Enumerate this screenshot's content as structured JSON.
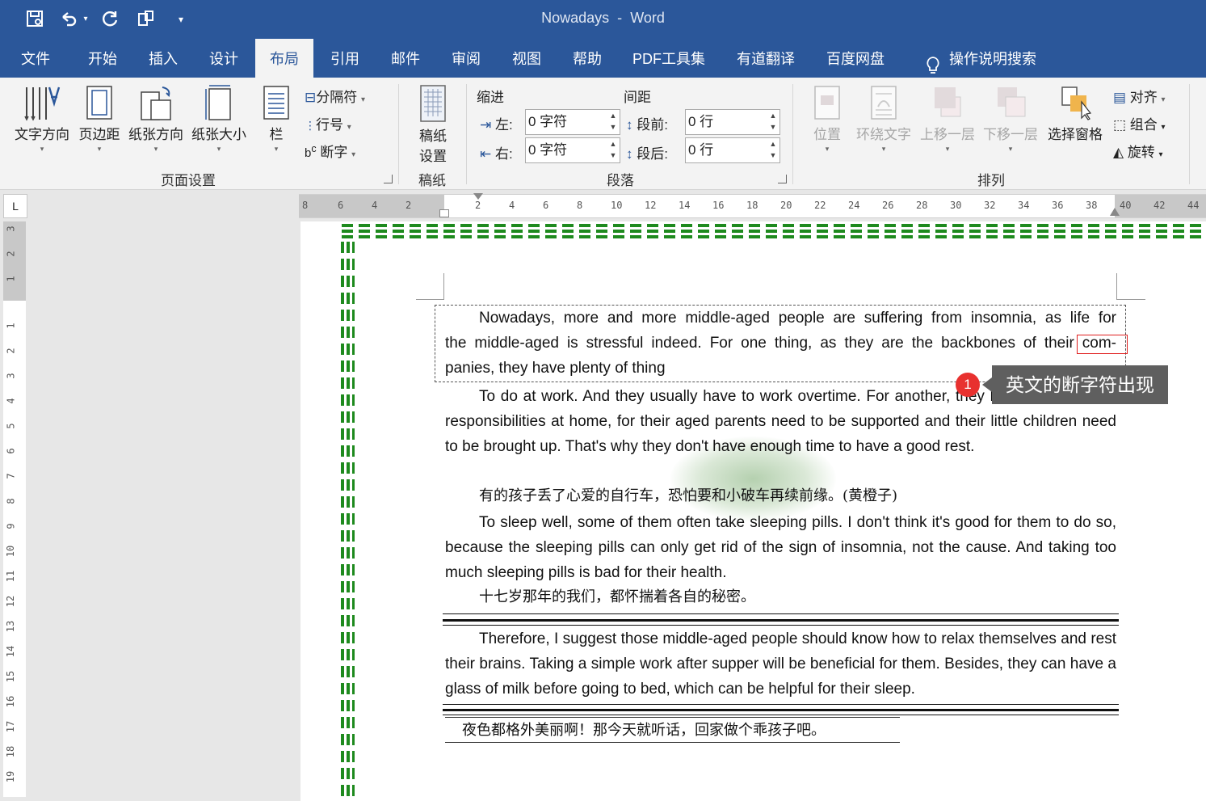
{
  "titlebar": {
    "doc_name": "Nowadays",
    "sep": "-",
    "app": "Word"
  },
  "tabs": [
    {
      "label": "文件"
    },
    {
      "label": "开始"
    },
    {
      "label": "插入"
    },
    {
      "label": "设计"
    },
    {
      "label": "布局",
      "active": true
    },
    {
      "label": "引用"
    },
    {
      "label": "邮件"
    },
    {
      "label": "审阅"
    },
    {
      "label": "视图"
    },
    {
      "label": "帮助"
    },
    {
      "label": "PDF工具集"
    },
    {
      "label": "有道翻译"
    },
    {
      "label": "百度网盘"
    },
    {
      "label": "操作说明搜索"
    }
  ],
  "ribbon": {
    "page_setup": {
      "text_direction": "文字方向",
      "margins": "页边距",
      "orientation": "纸张方向",
      "size": "纸张大小",
      "columns": "栏",
      "breaks": "分隔符",
      "line_numbers": "行号",
      "hyphenation": "断字",
      "group": "页面设置"
    },
    "draft": {
      "line1": "稿纸",
      "line2": "设置",
      "group": "稿纸"
    },
    "paragraph": {
      "indent": "缩进",
      "spacing": "间距",
      "left_label": "左:",
      "left_value": "0 字符",
      "right_label": "右:",
      "right_value": "0 字符",
      "before_label": "段前:",
      "before_value": "0 行",
      "after_label": "段后:",
      "after_value": "0 行",
      "group": "段落"
    },
    "arrange": {
      "position": "位置",
      "wrap": "环绕文字",
      "forward": "上移一层",
      "backward": "下移一层",
      "selection_pane": "选择窗格",
      "align": "对齐",
      "group_cmd": "组合",
      "rotate": "旋转",
      "group": "排列"
    }
  },
  "colors": {
    "brand": "#2b579a",
    "ribbon_bg": "#f3f3f3",
    "border_tree": "#1e8a1e",
    "badge": "#e8312f"
  },
  "ruler": {
    "h_left": [
      "8",
      "6",
      "4",
      "2"
    ],
    "h_right": [
      "2",
      "4",
      "6",
      "8",
      "10",
      "12",
      "14",
      "16",
      "18",
      "20",
      "22",
      "24",
      "26",
      "28",
      "30",
      "32",
      "34",
      "36",
      "38",
      "40",
      "42",
      "44"
    ],
    "v_top": [
      "3",
      "2",
      "1"
    ],
    "v_main": [
      "1",
      "2",
      "3",
      "4",
      "5",
      "6",
      "7",
      "8",
      "9",
      "10",
      "11",
      "12",
      "13",
      "14",
      "15",
      "16",
      "17",
      "18",
      "19"
    ]
  },
  "doc": {
    "p1_a": "Nowadays, more and more middle-aged people are suffering from insomnia, as life for",
    "p1_b": "the middle-aged is stressful indeed. For one thing, as they are the backbones of their",
    "p1_hyph": "com-",
    "p1_c": "panies, they have plenty of thing",
    "p2": "To do at work. And they usually have to work overtime. For another, they have to take great responsibilities at home, for their aged parents need to be supported and their little children need to be brought up. That's why they don't have enough time to have a good rest.",
    "cn1": "有的孩子丢了心爱的自行车，恐怕要和小破车再续前缘。(黄橙子)",
    "p3": "To sleep well, some of them often take sleeping pills. I don't think it's good for them to do so, because the sleeping pills can only get rid of the sign of insomnia, not the cause. And taking too much sleeping pills is bad for their health.",
    "cn2": "十七岁那年的我们，都怀揣着各自的秘密。",
    "p4": "Therefore, I suggest those middle-aged people should know how to relax themselves and rest their brains. Taking a simple work after supper will be beneficial for them. Besides, they can have a glass of milk before going to bed, which can be helpful for their sleep.",
    "cn3": "夜色都格外美丽啊！那今天就听话，回家做个乖孩子吧。"
  },
  "callout": {
    "badge": "1",
    "text": "英文的断字符出现"
  }
}
